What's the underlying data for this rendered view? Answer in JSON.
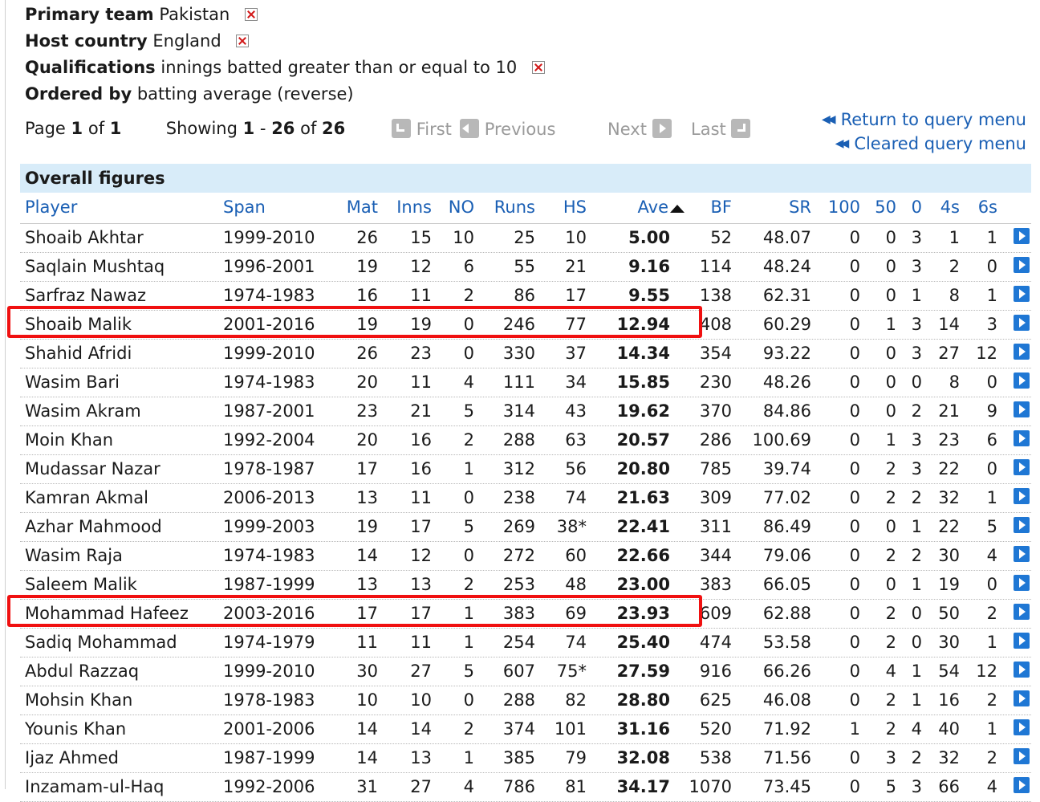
{
  "filters": [
    {
      "label": "Primary team",
      "value": "Pakistan",
      "removable": true
    },
    {
      "label": "Host country",
      "value": "England",
      "removable": true
    },
    {
      "label": "Qualifications",
      "value": "innings batted greater than or equal to 10",
      "removable": true
    },
    {
      "label": "Ordered by",
      "value": "batting average (reverse)",
      "removable": false
    }
  ],
  "pager": {
    "page_word": "Page",
    "page": "1",
    "of_word": "of",
    "total_pages": "1",
    "showing_word": "Showing",
    "from": "1",
    "dash": "-",
    "to": "26",
    "of2": "of",
    "total": "26"
  },
  "nav": {
    "first": "First",
    "previous": "Previous",
    "next": "Next",
    "last": "Last"
  },
  "links": {
    "return": "Return to query menu",
    "cleared": "Cleared query menu"
  },
  "table": {
    "title": "Overall figures",
    "columns": [
      "Player",
      "Span",
      "Mat",
      "Inns",
      "NO",
      "Runs",
      "HS",
      "Ave",
      "BF",
      "SR",
      "100",
      "50",
      "0",
      "4s",
      "6s"
    ],
    "sorted_column": "Ave",
    "rows": [
      [
        "Shoaib Akhtar",
        "1999-2010",
        "26",
        "15",
        "10",
        "25",
        "10",
        "5.00",
        "52",
        "48.07",
        "0",
        "0",
        "3",
        "1",
        "1"
      ],
      [
        "Saqlain Mushtaq",
        "1996-2001",
        "19",
        "12",
        "6",
        "55",
        "21",
        "9.16",
        "114",
        "48.24",
        "0",
        "0",
        "3",
        "2",
        "0"
      ],
      [
        "Sarfraz Nawaz",
        "1974-1983",
        "16",
        "11",
        "2",
        "86",
        "17",
        "9.55",
        "138",
        "62.31",
        "0",
        "0",
        "1",
        "8",
        "1"
      ],
      [
        "Shoaib Malik",
        "2001-2016",
        "19",
        "19",
        "0",
        "246",
        "77",
        "12.94",
        "408",
        "60.29",
        "0",
        "1",
        "3",
        "14",
        "3"
      ],
      [
        "Shahid Afridi",
        "1999-2010",
        "26",
        "23",
        "0",
        "330",
        "37",
        "14.34",
        "354",
        "93.22",
        "0",
        "0",
        "3",
        "27",
        "12"
      ],
      [
        "Wasim Bari",
        "1974-1983",
        "20",
        "11",
        "4",
        "111",
        "34",
        "15.85",
        "230",
        "48.26",
        "0",
        "0",
        "0",
        "8",
        "0"
      ],
      [
        "Wasim Akram",
        "1987-2001",
        "23",
        "21",
        "5",
        "314",
        "43",
        "19.62",
        "370",
        "84.86",
        "0",
        "0",
        "2",
        "21",
        "9"
      ],
      [
        "Moin Khan",
        "1992-2004",
        "20",
        "16",
        "2",
        "288",
        "63",
        "20.57",
        "286",
        "100.69",
        "0",
        "1",
        "3",
        "23",
        "6"
      ],
      [
        "Mudassar Nazar",
        "1978-1987",
        "17",
        "16",
        "1",
        "312",
        "56",
        "20.80",
        "785",
        "39.74",
        "0",
        "2",
        "3",
        "22",
        "0"
      ],
      [
        "Kamran Akmal",
        "2006-2013",
        "13",
        "11",
        "0",
        "238",
        "74",
        "21.63",
        "309",
        "77.02",
        "0",
        "2",
        "2",
        "32",
        "1"
      ],
      [
        "Azhar Mahmood",
        "1999-2003",
        "19",
        "17",
        "5",
        "269",
        "38*",
        "22.41",
        "311",
        "86.49",
        "0",
        "0",
        "1",
        "22",
        "5"
      ],
      [
        "Wasim Raja",
        "1974-1983",
        "14",
        "12",
        "0",
        "272",
        "60",
        "22.66",
        "344",
        "79.06",
        "0",
        "2",
        "2",
        "30",
        "4"
      ],
      [
        "Saleem Malik",
        "1987-1999",
        "13",
        "13",
        "2",
        "253",
        "48",
        "23.00",
        "383",
        "66.05",
        "0",
        "0",
        "1",
        "19",
        "0"
      ],
      [
        "Mohammad Hafeez",
        "2003-2016",
        "17",
        "17",
        "1",
        "383",
        "69",
        "23.93",
        "609",
        "62.88",
        "0",
        "2",
        "0",
        "50",
        "2"
      ],
      [
        "Sadiq Mohammad",
        "1974-1979",
        "11",
        "11",
        "1",
        "254",
        "74",
        "25.40",
        "474",
        "53.58",
        "0",
        "2",
        "0",
        "30",
        "1"
      ],
      [
        "Abdul Razzaq",
        "1999-2010",
        "30",
        "27",
        "5",
        "607",
        "75*",
        "27.59",
        "916",
        "66.26",
        "0",
        "4",
        "1",
        "54",
        "12"
      ],
      [
        "Mohsin Khan",
        "1978-1983",
        "10",
        "10",
        "0",
        "288",
        "82",
        "28.80",
        "625",
        "46.08",
        "0",
        "2",
        "1",
        "16",
        "2"
      ],
      [
        "Younis Khan",
        "2001-2006",
        "14",
        "14",
        "2",
        "374",
        "101",
        "31.16",
        "520",
        "71.92",
        "1",
        "2",
        "4",
        "40",
        "1"
      ],
      [
        "Ijaz Ahmed",
        "1987-1999",
        "14",
        "13",
        "1",
        "385",
        "79",
        "32.08",
        "538",
        "71.56",
        "0",
        "3",
        "2",
        "32",
        "2"
      ],
      [
        "Inzamam-ul-Haq",
        "1992-2006",
        "31",
        "27",
        "4",
        "786",
        "81",
        "34.17",
        "1070",
        "73.45",
        "0",
        "5",
        "3",
        "66",
        "4"
      ]
    ],
    "highlighted_players": [
      "Shoaib Malik",
      "Mohammad Hafeez"
    ]
  },
  "colors": {
    "link": "#1a5fb4",
    "banner": "#d8ecf9",
    "highlight": "#f01010",
    "play_icon": "#1f77d4"
  },
  "icons": {
    "remove_filter": "red-x-icon",
    "row_action": "play-arrow-icon",
    "nav_links": "double-arrow-left-icon"
  }
}
